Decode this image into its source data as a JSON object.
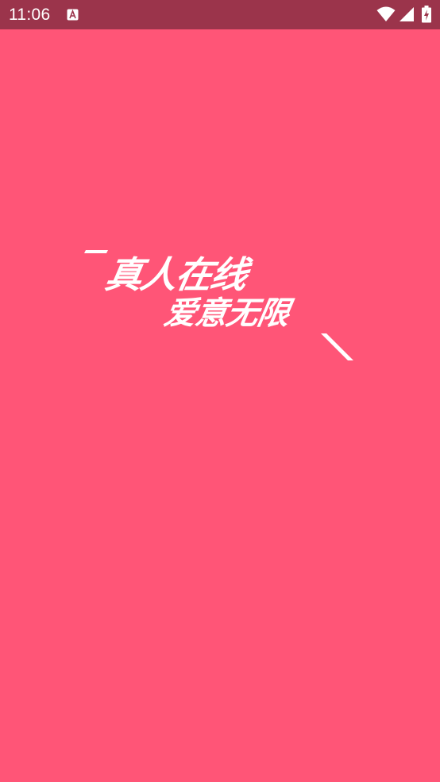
{
  "status_bar": {
    "time": "11:06",
    "notification_icon": "a-letter-icon",
    "wifi_icon": "wifi-icon",
    "signal_icon": "cell-signal-icon",
    "battery_icon": "battery-charging-icon",
    "background_color": "#9B344B"
  },
  "splash": {
    "background_color": "#FF5577",
    "slogan_line1": "真人在线",
    "slogan_line2": "爱意无限",
    "text_color": "#FFFFFF"
  }
}
